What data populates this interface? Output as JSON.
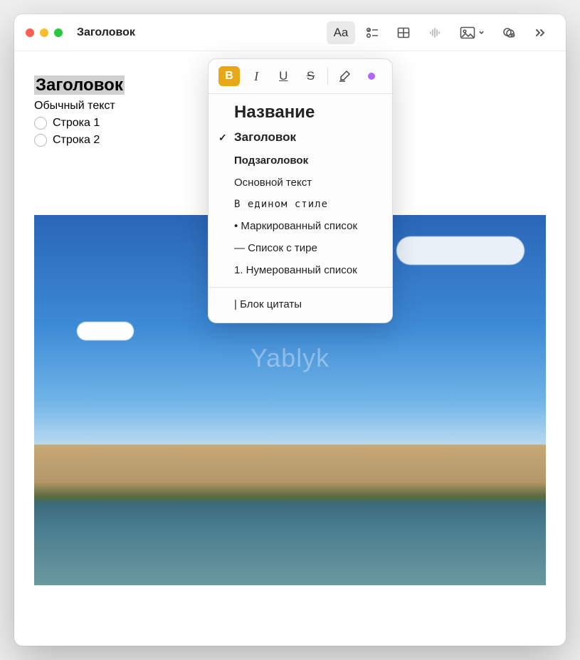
{
  "window": {
    "title": "Заголовок"
  },
  "toolbar": {
    "format_label": "Aa"
  },
  "content": {
    "heading": "Заголовок",
    "plain_text": "Обычный текст",
    "checklist": [
      "Строка 1",
      "Строка 2"
    ]
  },
  "watermark": "Yablyk",
  "popover": {
    "format_buttons": {
      "bold": "B",
      "italic": "I",
      "underline": "U",
      "strike": "S"
    },
    "styles": {
      "title": "Название",
      "heading": "Заголовок",
      "subheading": "Подзаголовок",
      "body": "Основной текст",
      "mono": "В едином стиле",
      "bulleted": "• Маркированный список",
      "dashed": "— Список с тире",
      "numbered": "1. Нумерованный список",
      "blockquote": "| Блок цитаты"
    },
    "selected": "heading"
  }
}
